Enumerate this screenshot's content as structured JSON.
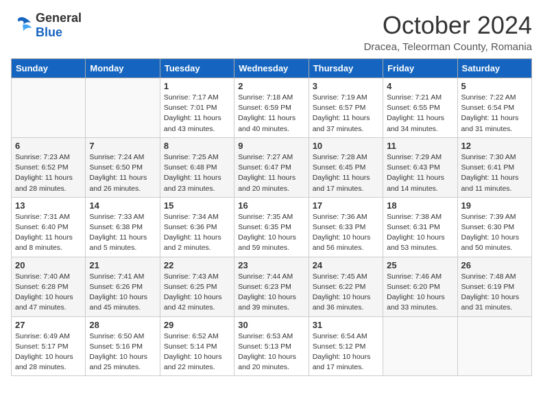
{
  "header": {
    "logo_general": "General",
    "logo_blue": "Blue",
    "title": "October 2024",
    "location": "Dracea, Teleorman County, Romania"
  },
  "weekdays": [
    "Sunday",
    "Monday",
    "Tuesday",
    "Wednesday",
    "Thursday",
    "Friday",
    "Saturday"
  ],
  "weeks": [
    [
      {
        "day": "",
        "detail": ""
      },
      {
        "day": "",
        "detail": ""
      },
      {
        "day": "1",
        "detail": "Sunrise: 7:17 AM\nSunset: 7:01 PM\nDaylight: 11 hours and 43 minutes."
      },
      {
        "day": "2",
        "detail": "Sunrise: 7:18 AM\nSunset: 6:59 PM\nDaylight: 11 hours and 40 minutes."
      },
      {
        "day": "3",
        "detail": "Sunrise: 7:19 AM\nSunset: 6:57 PM\nDaylight: 11 hours and 37 minutes."
      },
      {
        "day": "4",
        "detail": "Sunrise: 7:21 AM\nSunset: 6:55 PM\nDaylight: 11 hours and 34 minutes."
      },
      {
        "day": "5",
        "detail": "Sunrise: 7:22 AM\nSunset: 6:54 PM\nDaylight: 11 hours and 31 minutes."
      }
    ],
    [
      {
        "day": "6",
        "detail": "Sunrise: 7:23 AM\nSunset: 6:52 PM\nDaylight: 11 hours and 28 minutes."
      },
      {
        "day": "7",
        "detail": "Sunrise: 7:24 AM\nSunset: 6:50 PM\nDaylight: 11 hours and 26 minutes."
      },
      {
        "day": "8",
        "detail": "Sunrise: 7:25 AM\nSunset: 6:48 PM\nDaylight: 11 hours and 23 minutes."
      },
      {
        "day": "9",
        "detail": "Sunrise: 7:27 AM\nSunset: 6:47 PM\nDaylight: 11 hours and 20 minutes."
      },
      {
        "day": "10",
        "detail": "Sunrise: 7:28 AM\nSunset: 6:45 PM\nDaylight: 11 hours and 17 minutes."
      },
      {
        "day": "11",
        "detail": "Sunrise: 7:29 AM\nSunset: 6:43 PM\nDaylight: 11 hours and 14 minutes."
      },
      {
        "day": "12",
        "detail": "Sunrise: 7:30 AM\nSunset: 6:41 PM\nDaylight: 11 hours and 11 minutes."
      }
    ],
    [
      {
        "day": "13",
        "detail": "Sunrise: 7:31 AM\nSunset: 6:40 PM\nDaylight: 11 hours and 8 minutes."
      },
      {
        "day": "14",
        "detail": "Sunrise: 7:33 AM\nSunset: 6:38 PM\nDaylight: 11 hours and 5 minutes."
      },
      {
        "day": "15",
        "detail": "Sunrise: 7:34 AM\nSunset: 6:36 PM\nDaylight: 11 hours and 2 minutes."
      },
      {
        "day": "16",
        "detail": "Sunrise: 7:35 AM\nSunset: 6:35 PM\nDaylight: 10 hours and 59 minutes."
      },
      {
        "day": "17",
        "detail": "Sunrise: 7:36 AM\nSunset: 6:33 PM\nDaylight: 10 hours and 56 minutes."
      },
      {
        "day": "18",
        "detail": "Sunrise: 7:38 AM\nSunset: 6:31 PM\nDaylight: 10 hours and 53 minutes."
      },
      {
        "day": "19",
        "detail": "Sunrise: 7:39 AM\nSunset: 6:30 PM\nDaylight: 10 hours and 50 minutes."
      }
    ],
    [
      {
        "day": "20",
        "detail": "Sunrise: 7:40 AM\nSunset: 6:28 PM\nDaylight: 10 hours and 47 minutes."
      },
      {
        "day": "21",
        "detail": "Sunrise: 7:41 AM\nSunset: 6:26 PM\nDaylight: 10 hours and 45 minutes."
      },
      {
        "day": "22",
        "detail": "Sunrise: 7:43 AM\nSunset: 6:25 PM\nDaylight: 10 hours and 42 minutes."
      },
      {
        "day": "23",
        "detail": "Sunrise: 7:44 AM\nSunset: 6:23 PM\nDaylight: 10 hours and 39 minutes."
      },
      {
        "day": "24",
        "detail": "Sunrise: 7:45 AM\nSunset: 6:22 PM\nDaylight: 10 hours and 36 minutes."
      },
      {
        "day": "25",
        "detail": "Sunrise: 7:46 AM\nSunset: 6:20 PM\nDaylight: 10 hours and 33 minutes."
      },
      {
        "day": "26",
        "detail": "Sunrise: 7:48 AM\nSunset: 6:19 PM\nDaylight: 10 hours and 31 minutes."
      }
    ],
    [
      {
        "day": "27",
        "detail": "Sunrise: 6:49 AM\nSunset: 5:17 PM\nDaylight: 10 hours and 28 minutes."
      },
      {
        "day": "28",
        "detail": "Sunrise: 6:50 AM\nSunset: 5:16 PM\nDaylight: 10 hours and 25 minutes."
      },
      {
        "day": "29",
        "detail": "Sunrise: 6:52 AM\nSunset: 5:14 PM\nDaylight: 10 hours and 22 minutes."
      },
      {
        "day": "30",
        "detail": "Sunrise: 6:53 AM\nSunset: 5:13 PM\nDaylight: 10 hours and 20 minutes."
      },
      {
        "day": "31",
        "detail": "Sunrise: 6:54 AM\nSunset: 5:12 PM\nDaylight: 10 hours and 17 minutes."
      },
      {
        "day": "",
        "detail": ""
      },
      {
        "day": "",
        "detail": ""
      }
    ]
  ]
}
